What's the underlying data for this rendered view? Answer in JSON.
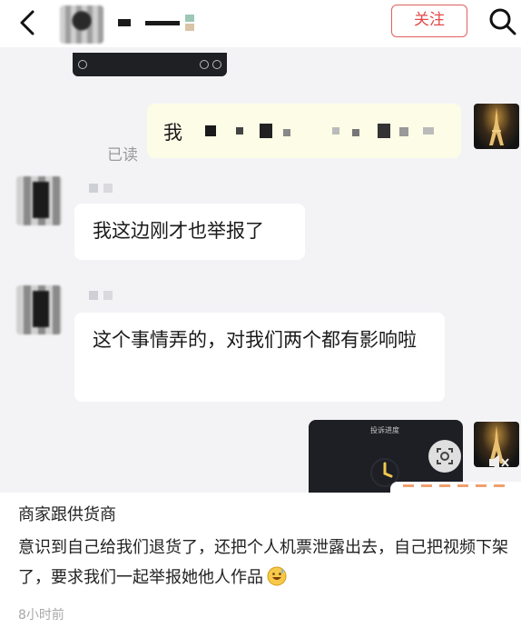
{
  "header": {
    "follow_label": "关注"
  },
  "chat": {
    "sent_message": {
      "text_visible": "我",
      "status": "已读"
    },
    "received_messages": [
      {
        "text": "我这边刚才也举报了"
      },
      {
        "text": "这个事情弄的，对我们两个都有影响啦"
      }
    ],
    "video_card": {
      "caption": "投诉进度"
    }
  },
  "caption": {
    "title": "商家跟供货商",
    "body": "意识到自己给我们退货了，还把个人机票泄露出去，自己把视频下架了，要求我们一起举报她他人作品",
    "emoji_icon": "grinning-sweat-emoji",
    "timestamp": "8小时前"
  },
  "icons": {
    "back": "chevron-left-icon",
    "search": "search-icon",
    "scan": "scan-icon",
    "mute": "mute-icon",
    "clock": "clock-icon"
  },
  "colors": {
    "follow_accent": "#e24a4a",
    "sent_bubble": "#fdfce6",
    "chat_background": "#f3f3f6"
  }
}
